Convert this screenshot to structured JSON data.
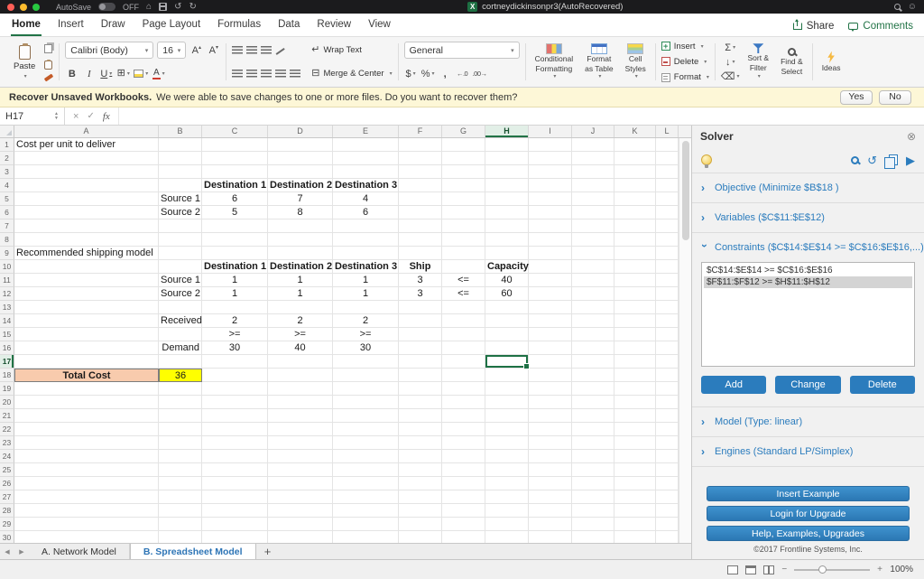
{
  "icons": {
    "home": "⌂",
    "undo": "↺",
    "redo": "↻",
    "smiley": "☺",
    "excel_badge": "X",
    "chevron": "›",
    "sum": "Σ",
    "fill_down": "↓",
    "clear": "⌫",
    "borders_icon": "⊞",
    "merge_icon": "⊟",
    "wrap_icon": "↵",
    "font_letter": "A",
    "sup_up": "▴",
    "sup_down": "▾",
    "close_pane": "⊗",
    "play": "▶",
    "nav_left": "◀",
    "nav_right": "▶",
    "add_sheet": "+",
    "cancel": "×",
    "checkmark": "✓",
    "stepper_up": "▲",
    "stepper_down": "▼",
    "dec_decrease": "←.0",
    "dec_increase": ".00→",
    "zoom_minus": "−",
    "zoom_plus": "+"
  },
  "titlebar": {
    "autosave_label": "AutoSave",
    "autosave_state": "OFF",
    "document_title": "cortneydickinsonpr3(AutoRecovered)"
  },
  "ribbon": {
    "tabs": [
      {
        "label": "Home",
        "active": true
      },
      {
        "label": "Insert",
        "active": false
      },
      {
        "label": "Draw",
        "active": false
      },
      {
        "label": "Page Layout",
        "active": false
      },
      {
        "label": "Formulas",
        "active": false
      },
      {
        "label": "Data",
        "active": false
      },
      {
        "label": "Review",
        "active": false
      },
      {
        "label": "View",
        "active": false
      }
    ],
    "share_label": "Share",
    "comments_label": "Comments",
    "clipboard": {
      "paste": "Paste"
    },
    "font": {
      "name": "Calibri (Body)",
      "size": "16",
      "bold": "B",
      "italic": "I",
      "underline": "U"
    },
    "alignment": {
      "wrap_text": "Wrap Text",
      "merge_center": "Merge & Center"
    },
    "number": {
      "format": "General",
      "currency": "$",
      "percent": "%",
      "comma": ","
    },
    "styles": {
      "conditional": [
        "Conditional",
        "Formatting"
      ],
      "table": [
        "Format",
        "as Table"
      ],
      "cell_styles": [
        "Cell",
        "Styles"
      ]
    },
    "cells": {
      "insert": "Insert",
      "delete": "Delete",
      "format": "Format"
    },
    "editing": {
      "sort_filter": [
        "Sort &",
        "Filter"
      ],
      "find_select": [
        "Find &",
        "Select"
      ],
      "ideas": "Ideas"
    }
  },
  "notification": {
    "title": "Recover Unsaved Workbooks.",
    "message": "We were able to save changes to one or more files. Do you want to recover them?",
    "yes_label": "Yes",
    "no_label": "No"
  },
  "formula_bar": {
    "name_box": "H17",
    "fx_label": "fx"
  },
  "sheet": {
    "columns": [
      "A",
      "B",
      "C",
      "D",
      "E",
      "F",
      "G",
      "H",
      "I",
      "J",
      "K",
      "L"
    ],
    "row_count": 30,
    "cells": [
      {
        "r": 1,
        "c": "A",
        "t": "Cost per unit to deliver",
        "a": "left"
      },
      {
        "r": 4,
        "c": "C",
        "t": "Destination 1",
        "a": "center",
        "b": true
      },
      {
        "r": 4,
        "c": "D",
        "t": "Destination 2",
        "a": "center",
        "b": true
      },
      {
        "r": 4,
        "c": "E",
        "t": "Destination 3",
        "a": "center",
        "b": true
      },
      {
        "r": 5,
        "c": "B",
        "t": "Source 1",
        "a": "right"
      },
      {
        "r": 5,
        "c": "C",
        "t": "6",
        "a": "center"
      },
      {
        "r": 5,
        "c": "D",
        "t": "7",
        "a": "center"
      },
      {
        "r": 5,
        "c": "E",
        "t": "4",
        "a": "center"
      },
      {
        "r": 6,
        "c": "B",
        "t": "Source 2",
        "a": "right"
      },
      {
        "r": 6,
        "c": "C",
        "t": "5",
        "a": "center"
      },
      {
        "r": 6,
        "c": "D",
        "t": "8",
        "a": "center"
      },
      {
        "r": 6,
        "c": "E",
        "t": "6",
        "a": "center"
      },
      {
        "r": 9,
        "c": "A",
        "t": "Recommended shipping model",
        "a": "left"
      },
      {
        "r": 10,
        "c": "C",
        "t": "Destination 1",
        "a": "center",
        "b": true
      },
      {
        "r": 10,
        "c": "D",
        "t": "Destination 2",
        "a": "center",
        "b": true
      },
      {
        "r": 10,
        "c": "E",
        "t": "Destination 3",
        "a": "center",
        "b": true
      },
      {
        "r": 10,
        "c": "F",
        "t": "Ship",
        "a": "center",
        "b": true
      },
      {
        "r": 10,
        "c": "H",
        "t": "Capacity",
        "a": "center",
        "b": true
      },
      {
        "r": 11,
        "c": "B",
        "t": "Source 1",
        "a": "right"
      },
      {
        "r": 11,
        "c": "C",
        "t": "1",
        "a": "center"
      },
      {
        "r": 11,
        "c": "D",
        "t": "1",
        "a": "center"
      },
      {
        "r": 11,
        "c": "E",
        "t": "1",
        "a": "center"
      },
      {
        "r": 11,
        "c": "F",
        "t": "3",
        "a": "center"
      },
      {
        "r": 11,
        "c": "G",
        "t": "<=",
        "a": "center"
      },
      {
        "r": 11,
        "c": "H",
        "t": "40",
        "a": "center"
      },
      {
        "r": 12,
        "c": "B",
        "t": "Source 2",
        "a": "right"
      },
      {
        "r": 12,
        "c": "C",
        "t": "1",
        "a": "center"
      },
      {
        "r": 12,
        "c": "D",
        "t": "1",
        "a": "center"
      },
      {
        "r": 12,
        "c": "E",
        "t": "1",
        "a": "center"
      },
      {
        "r": 12,
        "c": "F",
        "t": "3",
        "a": "center"
      },
      {
        "r": 12,
        "c": "G",
        "t": "<=",
        "a": "center"
      },
      {
        "r": 12,
        "c": "H",
        "t": "60",
        "a": "center"
      },
      {
        "r": 14,
        "c": "B",
        "t": "Received",
        "a": "right"
      },
      {
        "r": 14,
        "c": "C",
        "t": "2",
        "a": "center"
      },
      {
        "r": 14,
        "c": "D",
        "t": "2",
        "a": "center"
      },
      {
        "r": 14,
        "c": "E",
        "t": "2",
        "a": "center"
      },
      {
        "r": 15,
        "c": "C",
        "t": ">=",
        "a": "center"
      },
      {
        "r": 15,
        "c": "D",
        "t": ">=",
        "a": "center"
      },
      {
        "r": 15,
        "c": "E",
        "t": ">=",
        "a": "center"
      },
      {
        "r": 16,
        "c": "B",
        "t": "Demand",
        "a": "right"
      },
      {
        "r": 16,
        "c": "C",
        "t": "30",
        "a": "center"
      },
      {
        "r": 16,
        "c": "D",
        "t": "40",
        "a": "center"
      },
      {
        "r": 16,
        "c": "E",
        "t": "30",
        "a": "center"
      },
      {
        "r": 18,
        "c": "A",
        "t": "Total Cost",
        "a": "center",
        "b": true,
        "bg": "#f8cbad",
        "box": true
      },
      {
        "r": 18,
        "c": "B",
        "t": "36",
        "a": "center",
        "bg": "#ffff00",
        "box": true
      }
    ]
  },
  "sheet_tabs": {
    "tabs": [
      {
        "label": "A. Network Model",
        "active": false
      },
      {
        "label": "B. Spreadsheet Model",
        "active": true
      }
    ]
  },
  "solver": {
    "title": "Solver",
    "objective": "Objective (Minimize $B$18 )",
    "variables": "Variables ($C$11:$E$12)",
    "constraints": "Constraints ($C$14:$E$14 >= $C$16:$E$16,...)",
    "constraints_list": [
      "$C$14:$E$14 >= $C$16:$E$16",
      "$F$11:$F$12 >= $H$11:$H$12"
    ],
    "selected_constraint_index": 1,
    "add_label": "Add",
    "change_label": "Change",
    "delete_label": "Delete",
    "model": "Model (Type: linear)",
    "engines": "Engines (Standard LP/Simplex)",
    "footer_buttons": [
      "Insert Example",
      "Login for Upgrade",
      "Help, Examples, Upgrades"
    ],
    "copyright": "©2017 Frontline Systems, Inc."
  },
  "status_bar": {
    "zoom": "100%"
  }
}
